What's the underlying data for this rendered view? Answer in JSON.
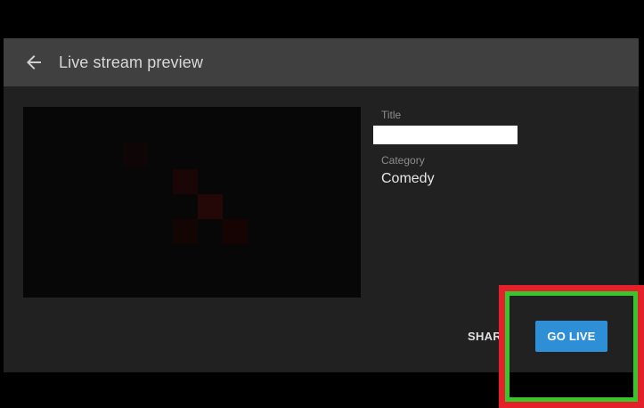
{
  "header": {
    "back_icon": "arrow-back-icon",
    "title": "Live stream preview"
  },
  "form": {
    "title_label": "Title",
    "title_value": "",
    "category_label": "Category",
    "category_value": "Comedy"
  },
  "actions": {
    "share_label": "SHARE",
    "go_live_label": "GO LIVE"
  },
  "colors": {
    "accent": "#2f8fd6",
    "highlight_outer": "#e4202a",
    "highlight_inner": "#39c52c"
  }
}
